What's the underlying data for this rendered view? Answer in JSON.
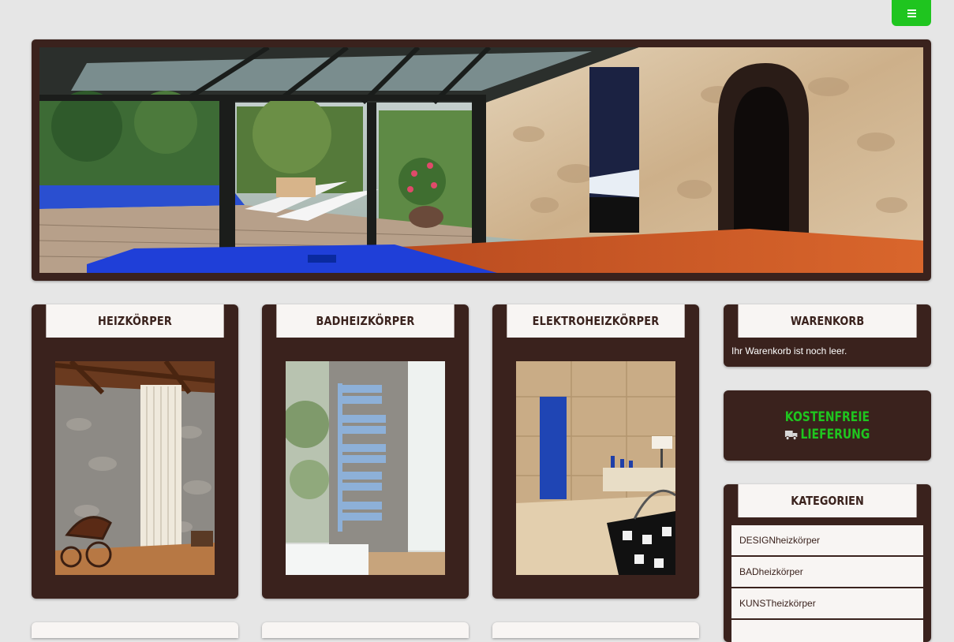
{
  "header": {
    "menu_icon": "hamburger-icon",
    "accent": "#1fc51f"
  },
  "colors": {
    "brand_dark": "#3a221d",
    "panel_light": "#f8f5f3",
    "background": "#e6e6e6"
  },
  "categories_cards": [
    {
      "title": "HEIZKÖRPER"
    },
    {
      "title": "BADHEIZKÖRPER"
    },
    {
      "title": "ELEKTROHEIZKÖRPER"
    }
  ],
  "cart": {
    "title": "WARENKORB",
    "text": "Ihr Warenkorb ist noch leer."
  },
  "shipping": {
    "line1": "KOSTENFREIE",
    "line2": "LIEFERUNG",
    "icon": "truck-icon"
  },
  "kategorien": {
    "title": "KATEGORIEN",
    "items": [
      "DESIGNheizkörper",
      "BADheizkörper",
      "KUNSTheizkörper"
    ]
  }
}
